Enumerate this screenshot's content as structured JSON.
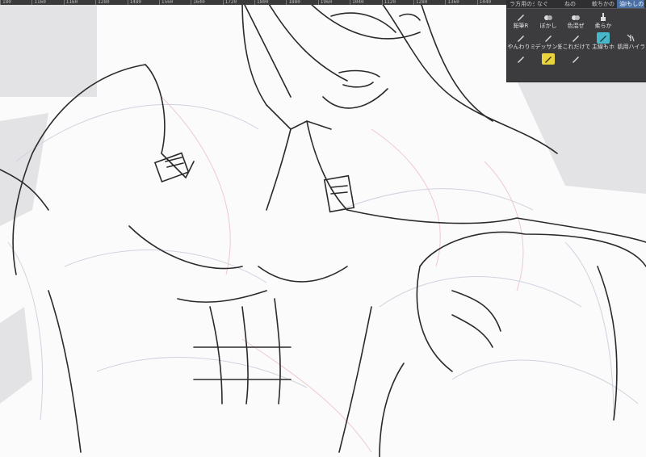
{
  "ruler": {
    "ticks": [
      "180",
      "1160",
      "1160",
      "1280",
      "1480",
      "1560",
      "1640",
      "1720",
      "1800",
      "1880",
      "1960",
      "1040",
      "1120",
      "1280",
      "1360",
      "1440"
    ]
  },
  "palette": {
    "top_tabs": [
      {
        "label": "ラ方用のシ"
      },
      {
        "label": "なぐ"
      },
      {
        "label": "ねの"
      },
      {
        "label": "軟ちかの"
      },
      {
        "label": "油Iもしの"
      }
    ],
    "tools": [
      {
        "label": "鉛筆R",
        "icon": "pencil-icon"
      },
      {
        "label": "ぼかし",
        "icon": "blur-drops-icon"
      },
      {
        "label": "色混ぜ",
        "icon": "color-mix-drops-icon"
      },
      {
        "label": "柔らか",
        "icon": "soft-brush-icon"
      },
      {
        "label": "",
        "icon": "empty"
      },
      {
        "label": "やんわりミリ",
        "icon": "pen-icon"
      },
      {
        "label": "デッサン鉛筆",
        "icon": "pencil-icon"
      },
      {
        "label": "これだけで!",
        "icon": "pen-icon"
      },
      {
        "label": "主線もホ",
        "icon": "highlight-pen-icon"
      },
      {
        "label": "肌用ハイラ",
        "icon": "brush-set-icon"
      },
      {
        "label": "",
        "icon": "pen-icon"
      },
      {
        "label": "",
        "icon": "yellow-highlight-icon"
      },
      {
        "label": "",
        "icon": "pen-icon"
      }
    ]
  }
}
